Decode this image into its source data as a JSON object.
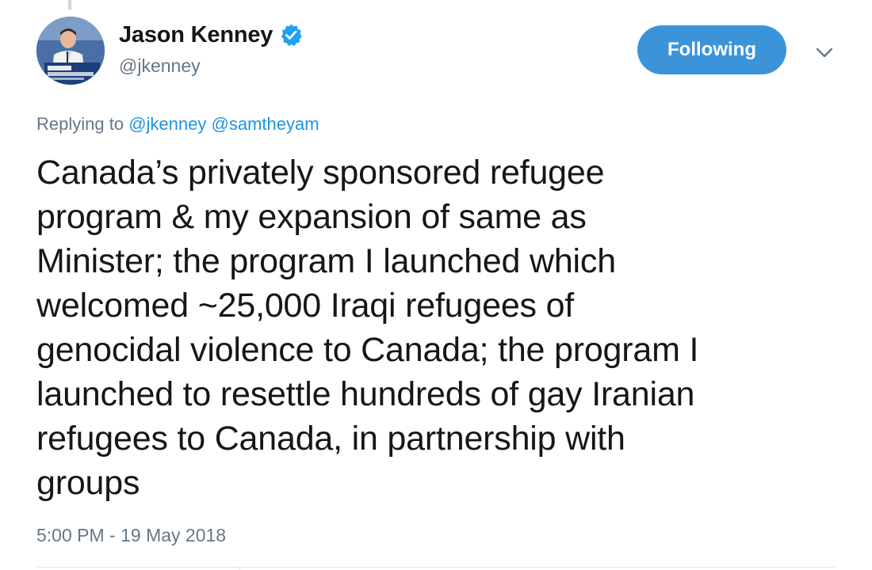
{
  "tweet": {
    "author": {
      "display_name": "Jason Kenney",
      "handle": "@jkenney",
      "verified": true,
      "avatar_icon": "profile-photo-icon"
    },
    "follow_button_label": "Following",
    "menu_icon": "chevron-down-icon",
    "replying": {
      "prefix": "Replying to",
      "mentions": [
        "@jkenney",
        "@samtheyam"
      ]
    },
    "text_lines": [
      "Canada’s privately sponsored refugee",
      "program & my expansion of same as",
      "Minister; the program I launched which",
      "welcomed ~25,000 Iraqi refugees of",
      "genocidal violence to Canada; the program I",
      "launched to resettle hundreds of gay Iranian",
      "refugees to Canada, in partnership with",
      "groups"
    ],
    "timestamp": "5:00 PM - 19 May 2018"
  },
  "colors": {
    "follow_button": "#3b94d9",
    "link": "#1b95e0",
    "secondary_text": "#657786",
    "verified_badge": "#1da1f2"
  }
}
